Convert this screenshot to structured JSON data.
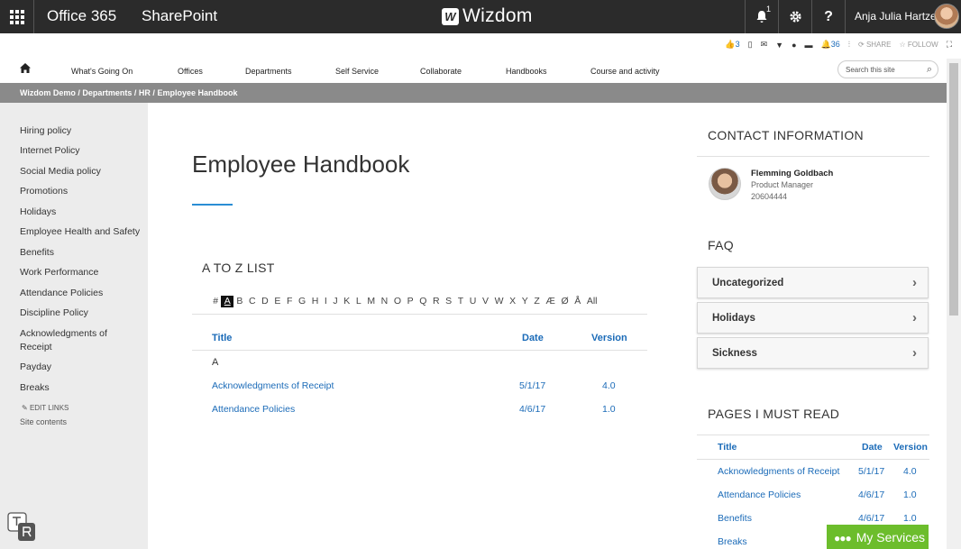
{
  "suitebar": {
    "app_title": "Office 365",
    "site_title": "SharePoint",
    "logo_text": "Wizdom",
    "notification_count": "1",
    "settings_icon": "gear-icon",
    "help_label": "?",
    "user_name": "Anja Julia Hartzell"
  },
  "actions": {
    "likes_count": "3",
    "alerts_count": "36",
    "share_label": "SHARE",
    "follow_label": "FOLLOW"
  },
  "nav": {
    "items": [
      "What's Going On",
      "Offices",
      "Departments",
      "Self Service",
      "Collaborate",
      "Handbooks",
      "Course and activity"
    ],
    "search_placeholder": "Search this site"
  },
  "breadcrumb": "Wizdom Demo /  Departments /  HR / Employee Handbook",
  "leftnav": {
    "items": [
      "Hiring policy",
      "Internet Policy",
      "Social Media policy",
      "Promotions",
      "Holidays",
      "Employee Health and Safety",
      "Benefits",
      "Work Performance",
      "Attendance Policies",
      "Discipline Policy",
      "Acknowledgments of Receipt",
      "Payday",
      "Breaks"
    ],
    "edit_links": "EDIT LINKS",
    "site_contents": "Site contents"
  },
  "main": {
    "title": "Employee Handbook",
    "az_heading": "A TO Z LIST",
    "letters": [
      "#",
      "A",
      "B",
      "C",
      "D",
      "E",
      "F",
      "G",
      "H",
      "I",
      "J",
      "K",
      "L",
      "M",
      "N",
      "O",
      "P",
      "Q",
      "R",
      "S",
      "T",
      "U",
      "V",
      "W",
      "X",
      "Y",
      "Z",
      "Æ",
      "Ø",
      "Å",
      "All"
    ],
    "active_letter": "A",
    "columns": {
      "title": "Title",
      "date": "Date",
      "version": "Version"
    },
    "group_letter": "A",
    "rows": [
      {
        "title": "Acknowledgments of Receipt",
        "date": "5/1/17",
        "version": "4.0"
      },
      {
        "title": "Attendance Policies",
        "date": "4/6/17",
        "version": "1.0"
      }
    ]
  },
  "contact": {
    "heading": "CONTACT INFORMATION",
    "name": "Flemming Goldbach",
    "role": "Product Manager",
    "phone": "20604444"
  },
  "faq": {
    "heading": "FAQ",
    "items": [
      "Uncategorized",
      "Holidays",
      "Sickness"
    ]
  },
  "must_read": {
    "heading": "PAGES I MUST READ",
    "columns": {
      "title": "Title",
      "date": "Date",
      "version": "Version"
    },
    "rows": [
      {
        "title": "Acknowledgments of Receipt",
        "date": "5/1/17",
        "version": "4.0"
      },
      {
        "title": "Attendance Policies",
        "date": "4/6/17",
        "version": "1.0"
      },
      {
        "title": "Benefits",
        "date": "4/6/17",
        "version": "1.0"
      },
      {
        "title": "Breaks",
        "date": "",
        "version": ""
      }
    ]
  },
  "my_services": "My Services",
  "colors": {
    "suite_bar": "#2b2b2b",
    "link_blue": "#1b6bb8",
    "accent_green": "#6cbd2c",
    "breadcrumb_gray": "#8a8a8a"
  }
}
